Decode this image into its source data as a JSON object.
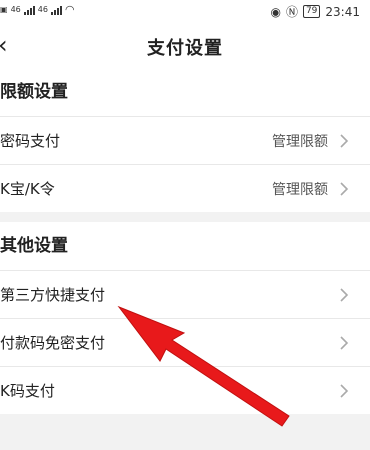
{
  "status": {
    "left_net": "46",
    "battery": "79",
    "time": "23:41"
  },
  "nav": {
    "title": "支付设置"
  },
  "limit_section": {
    "title": "限额设置",
    "rows": [
      {
        "label": "密码支付",
        "action": "管理限额"
      },
      {
        "label": "K宝/K令",
        "action": "管理限额"
      }
    ]
  },
  "other_section": {
    "title": "其他设置",
    "rows": [
      {
        "label": "第三方快捷支付"
      },
      {
        "label": "付款码免密支付"
      },
      {
        "label": "K码支付"
      }
    ]
  },
  "colors": {
    "arrow": "#e8191b",
    "background": "#f2f2f2"
  }
}
